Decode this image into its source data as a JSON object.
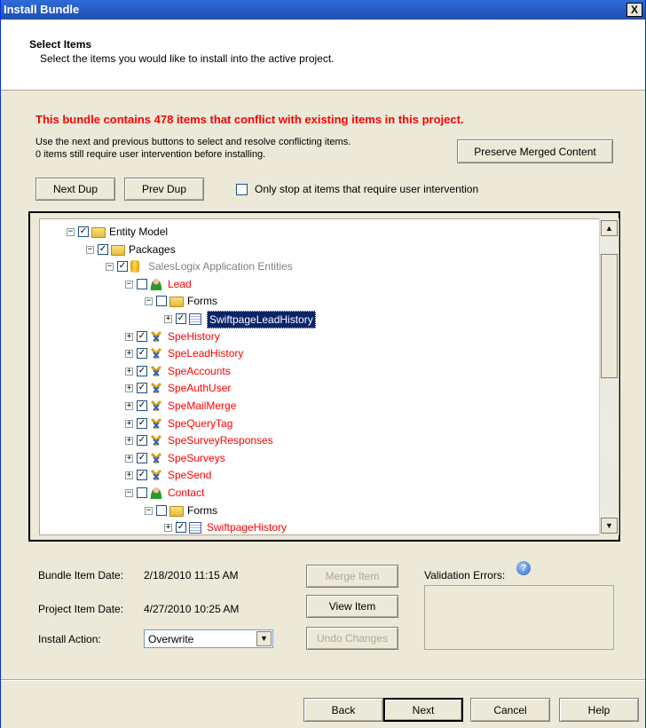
{
  "window": {
    "title": "Install Bundle",
    "close_glyph": "X"
  },
  "header": {
    "title": "Select Items",
    "subtitle": "Select the items you would like to install into the active project."
  },
  "conflict": {
    "message": "This bundle contains 478 items that conflict with existing items in this project.",
    "instruction_line1": "Use the next and previous buttons to select and resolve conflicting items.",
    "instruction_line2": "0 items still require user intervention before installing."
  },
  "buttons": {
    "preserve": "Preserve Merged Content",
    "next_dup": "Next Dup",
    "prev_dup": "Prev Dup",
    "merge": "Merge Item",
    "view": "View Item",
    "undo": "Undo Changes",
    "back": "Back",
    "next": "Next",
    "cancel": "Cancel",
    "help": "Help"
  },
  "only_stop": {
    "label": "Only stop at items that require user intervention",
    "checked": false
  },
  "tree": {
    "nodes": [
      {
        "label": "Entity Model",
        "depth": 0,
        "icon": "folder-open-icon",
        "checked": true,
        "color": "#000000"
      },
      {
        "label": "Packages",
        "depth": 1,
        "icon": "folder-open-icon",
        "checked": true,
        "color": "#000000"
      },
      {
        "label": "SalesLogix Application Entities",
        "depth": 2,
        "icon": "database-icon",
        "checked": true,
        "color": "#808080"
      },
      {
        "label": "Lead",
        "depth": 3,
        "icon": "person-icon",
        "checked": false,
        "color": "#ff0000"
      },
      {
        "label": "Forms",
        "depth": 4,
        "icon": "folder-icon",
        "checked": false,
        "color": "#000000"
      },
      {
        "label": "SwiftpageLeadHistory",
        "depth": 5,
        "icon": "form-icon",
        "checked": true,
        "color": "#000000",
        "selected": true
      },
      {
        "label": "SpeHistory",
        "depth": 3,
        "icon": "entity-icon",
        "checked": true,
        "color": "#ff0000"
      },
      {
        "label": "SpeLeadHistory",
        "depth": 3,
        "icon": "entity-icon",
        "checked": true,
        "color": "#ff0000"
      },
      {
        "label": "SpeAccounts",
        "depth": 3,
        "icon": "entity-icon",
        "checked": true,
        "color": "#ff0000"
      },
      {
        "label": "SpeAuthUser",
        "depth": 3,
        "icon": "entity-icon",
        "checked": true,
        "color": "#ff0000"
      },
      {
        "label": "SpeMailMerge",
        "depth": 3,
        "icon": "entity-icon",
        "checked": true,
        "color": "#ff0000"
      },
      {
        "label": "SpeQueryTag",
        "depth": 3,
        "icon": "entity-icon",
        "checked": true,
        "color": "#ff0000"
      },
      {
        "label": "SpeSurveyResponses",
        "depth": 3,
        "icon": "entity-icon",
        "checked": true,
        "color": "#ff0000"
      },
      {
        "label": "SpeSurveys",
        "depth": 3,
        "icon": "entity-icon",
        "checked": true,
        "color": "#ff0000"
      },
      {
        "label": "SpeSend",
        "depth": 3,
        "icon": "entity-icon",
        "checked": true,
        "color": "#ff0000"
      },
      {
        "label": "Contact",
        "depth": 3,
        "icon": "person-icon",
        "checked": false,
        "color": "#ff0000"
      },
      {
        "label": "Forms",
        "depth": 4,
        "icon": "folder-icon",
        "checked": false,
        "color": "#000000"
      },
      {
        "label": "SwiftpageHistory",
        "depth": 5,
        "icon": "form-icon",
        "checked": true,
        "color": "#ff0000"
      }
    ]
  },
  "details": {
    "bundle_date_label": "Bundle Item Date:",
    "bundle_date": "2/18/2010 11:15 AM",
    "project_date_label": "Project Item Date:",
    "project_date": "4/27/2010 10:25 AM",
    "install_action_label": "Install Action:",
    "install_action": "Overwrite",
    "validation_label": "Validation Errors:",
    "help_glyph": "?"
  },
  "colors": {
    "conflict": "#ff0000",
    "accent": "#0a246a"
  }
}
